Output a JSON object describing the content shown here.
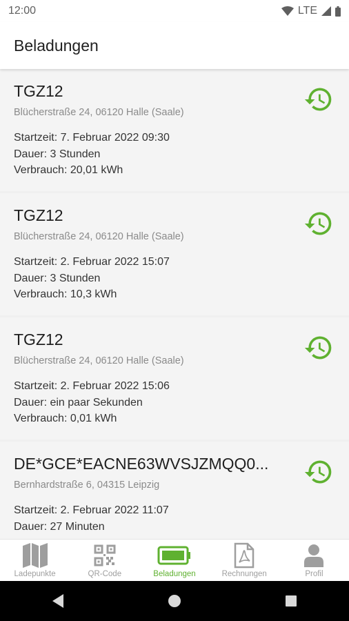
{
  "status_bar": {
    "time": "12:00",
    "network": "LTE"
  },
  "app_bar": {
    "title": "Beladungen"
  },
  "charges": [
    {
      "title": "TGZ12",
      "address": "Blücherstraße 24, 06120 Halle (Saale)",
      "start": "Startzeit: 7. Februar 2022 09:30",
      "duration": "Dauer: 3 Stunden",
      "consumption": "Verbrauch: 20,01 kWh"
    },
    {
      "title": "TGZ12",
      "address": "Blücherstraße 24, 06120 Halle (Saale)",
      "start": "Startzeit: 2. Februar 2022 15:07",
      "duration": "Dauer: 3 Stunden",
      "consumption": "Verbrauch: 10,3 kWh"
    },
    {
      "title": "TGZ12",
      "address": "Blücherstraße 24, 06120 Halle (Saale)",
      "start": "Startzeit: 2. Februar 2022 15:06",
      "duration": "Dauer: ein paar Sekunden",
      "consumption": "Verbrauch: 0,01 kWh"
    },
    {
      "title": "DE*GCE*EACNE63WVSJZMQQ0...",
      "address": "Bernhardstraße 6, 04315 Leipzig",
      "start": "Startzeit: 2. Februar 2022 11:07",
      "duration": "Dauer: 27 Minuten",
      "consumption": ""
    }
  ],
  "bottom_nav": {
    "items": [
      {
        "label": "Ladepunkte",
        "icon": "map-icon"
      },
      {
        "label": "QR-Code",
        "icon": "qr-code-icon"
      },
      {
        "label": "Beladungen",
        "icon": "battery-icon",
        "active": true
      },
      {
        "label": "Rechnungen",
        "icon": "pdf-document-icon"
      },
      {
        "label": "Profil",
        "icon": "person-icon"
      }
    ]
  },
  "colors": {
    "accent": "#5fb130",
    "inactive_icon": "#9e9e9e"
  }
}
